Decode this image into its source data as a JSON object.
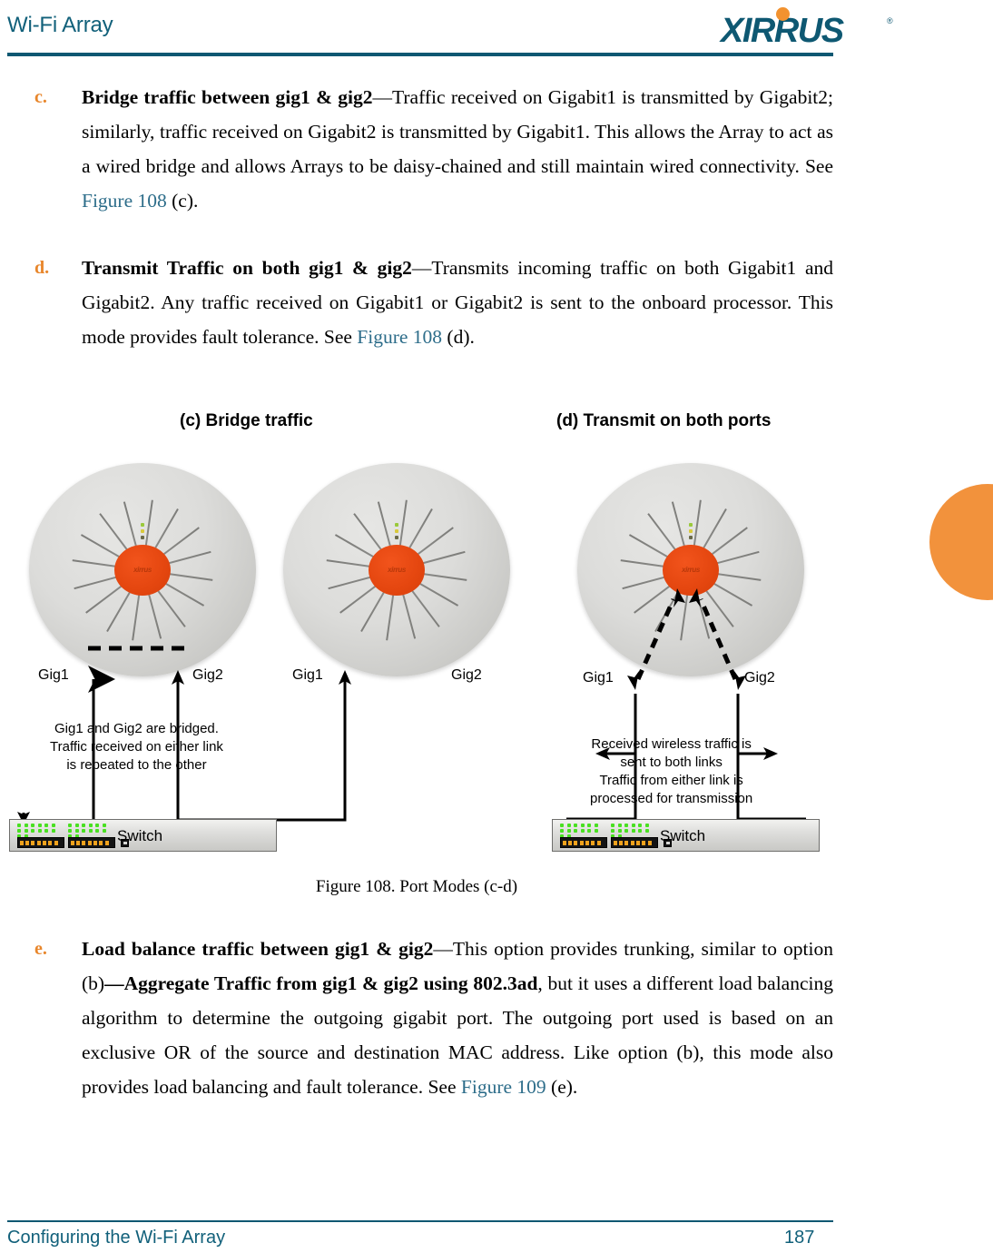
{
  "header": {
    "title": "Wi-Fi Array",
    "logo_text": "XIRRUS",
    "logo_registered": "®",
    "brand_color": "#0e5872",
    "accent_color": "#f2922f"
  },
  "paragraphs": [
    {
      "marker": "c.",
      "lead": "Bridge traffic between gig1 & gig2",
      "dash": "—",
      "body_1": "Traffic received on Gigabit1 is transmitted by Gigabit2; similarly, traffic received on Gigabit2 is transmitted by Gigabit1. This allows the Array to act as a wired bridge and allows Arrays to be daisy-chained and still maintain wired connectivity. See ",
      "xref": "Figure 108",
      "body_2": " (c)."
    },
    {
      "marker": "d.",
      "lead": "Transmit Traffic on both gig1 & gig2",
      "dash": "—",
      "body_1": "Transmits incoming traffic on both Gigabit1 and Gigabit2. Any traffic received on Gigabit1 or Gigabit2 is sent to the onboard processor.   This mode provides fault tolerance. See ",
      "xref": "Figure 108",
      "body_2": " (d)."
    },
    {
      "marker": "e.",
      "lead": "Load balance traffic between gig1 & gig2",
      "dash": "—",
      "body_1": "This option provides trunking, similar to option (b)",
      "lead_2": "—Aggregate Traffic from gig1 & gig2 using 802.3ad",
      "body_2": ", but it uses a different load balancing algorithm to determine the outgoing gigabit port. The outgoing port used is based on an exclusive OR of the source and destination MAC address. Like option (b), this mode also provides load balancing and fault tolerance. See ",
      "xref": "Figure 109",
      "body_3": " (e)."
    }
  ],
  "figure": {
    "sub_caption_c": "(c) Bridge traffic",
    "sub_caption_d": "(d) Transmit on both ports",
    "caption": "Figure 108. Port Modes (c-d)",
    "arrays": [
      {
        "id": "array-1",
        "hub_label": "xirrus",
        "gig1": "Gig1",
        "gig2": "Gig2"
      },
      {
        "id": "array-2",
        "hub_label": "xirrus",
        "gig1": "Gig1",
        "gig2": "Gig2"
      },
      {
        "id": "array-3",
        "hub_label": "xirrus",
        "gig1": "Gig1",
        "gig2": "Gig2"
      }
    ],
    "note_c": {
      "line1": "Gig1 and Gig2 are bridged.",
      "line2": "Traffic received on either link",
      "line3": "is repeated to the other"
    },
    "note_d": {
      "line1": "Received wireless traffic is",
      "line2": "sent to both links",
      "line3": "Traffic from either link is",
      "line4": "processed for transmission"
    },
    "switch_label_c": "Switch",
    "switch_label_d": "Switch"
  },
  "footer": {
    "left": "Configuring the Wi-Fi Array",
    "page": "187"
  }
}
